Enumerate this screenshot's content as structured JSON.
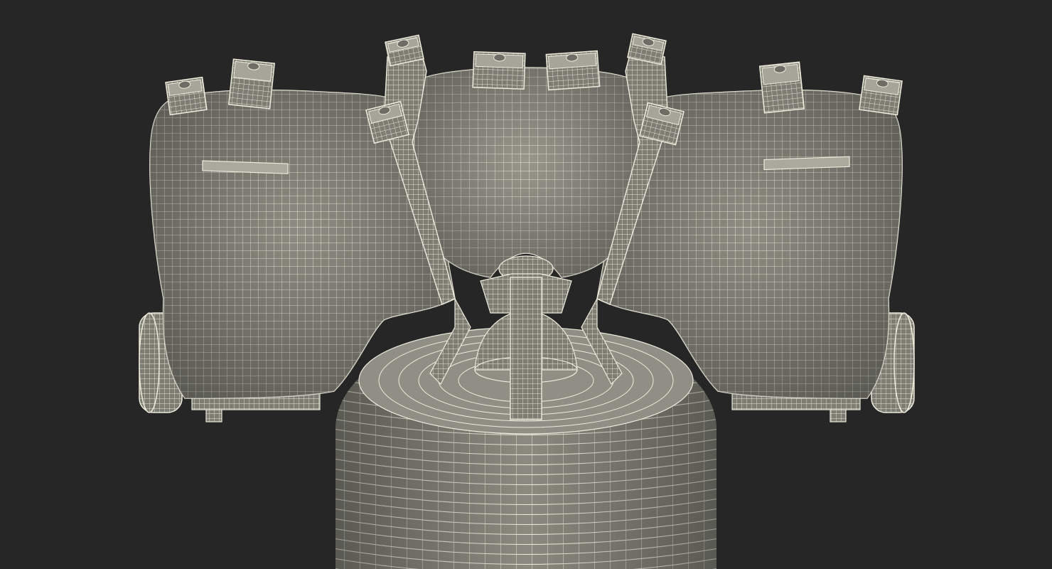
{
  "scene": {
    "background_color": "#262626",
    "surface_color": "#8e8e84",
    "wire_color": "#ecebdc",
    "shadow_color": "#5a5a52"
  }
}
